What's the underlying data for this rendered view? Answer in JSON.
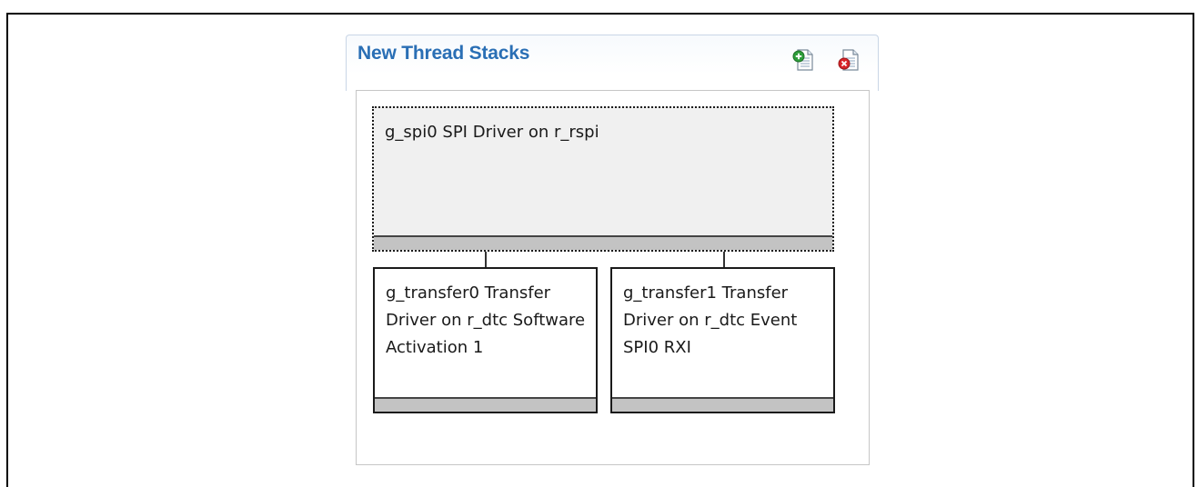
{
  "panel": {
    "title": "New Thread Stacks",
    "add_icon": "add-module-icon",
    "remove_icon": "remove-module-icon"
  },
  "modules": {
    "main": {
      "label": "g_spi0 SPI Driver on r_rspi",
      "selected": true
    },
    "children": [
      {
        "label": "g_transfer0 Transfer Driver on r_dtc Software Activation 1"
      },
      {
        "label": "g_transfer1 Transfer Driver on r_dtc Event SPI0 RXI"
      }
    ]
  },
  "colors": {
    "title": "#2a6fb5",
    "bar": "#c3c3c3",
    "selected_bg": "#f0f0f0"
  }
}
